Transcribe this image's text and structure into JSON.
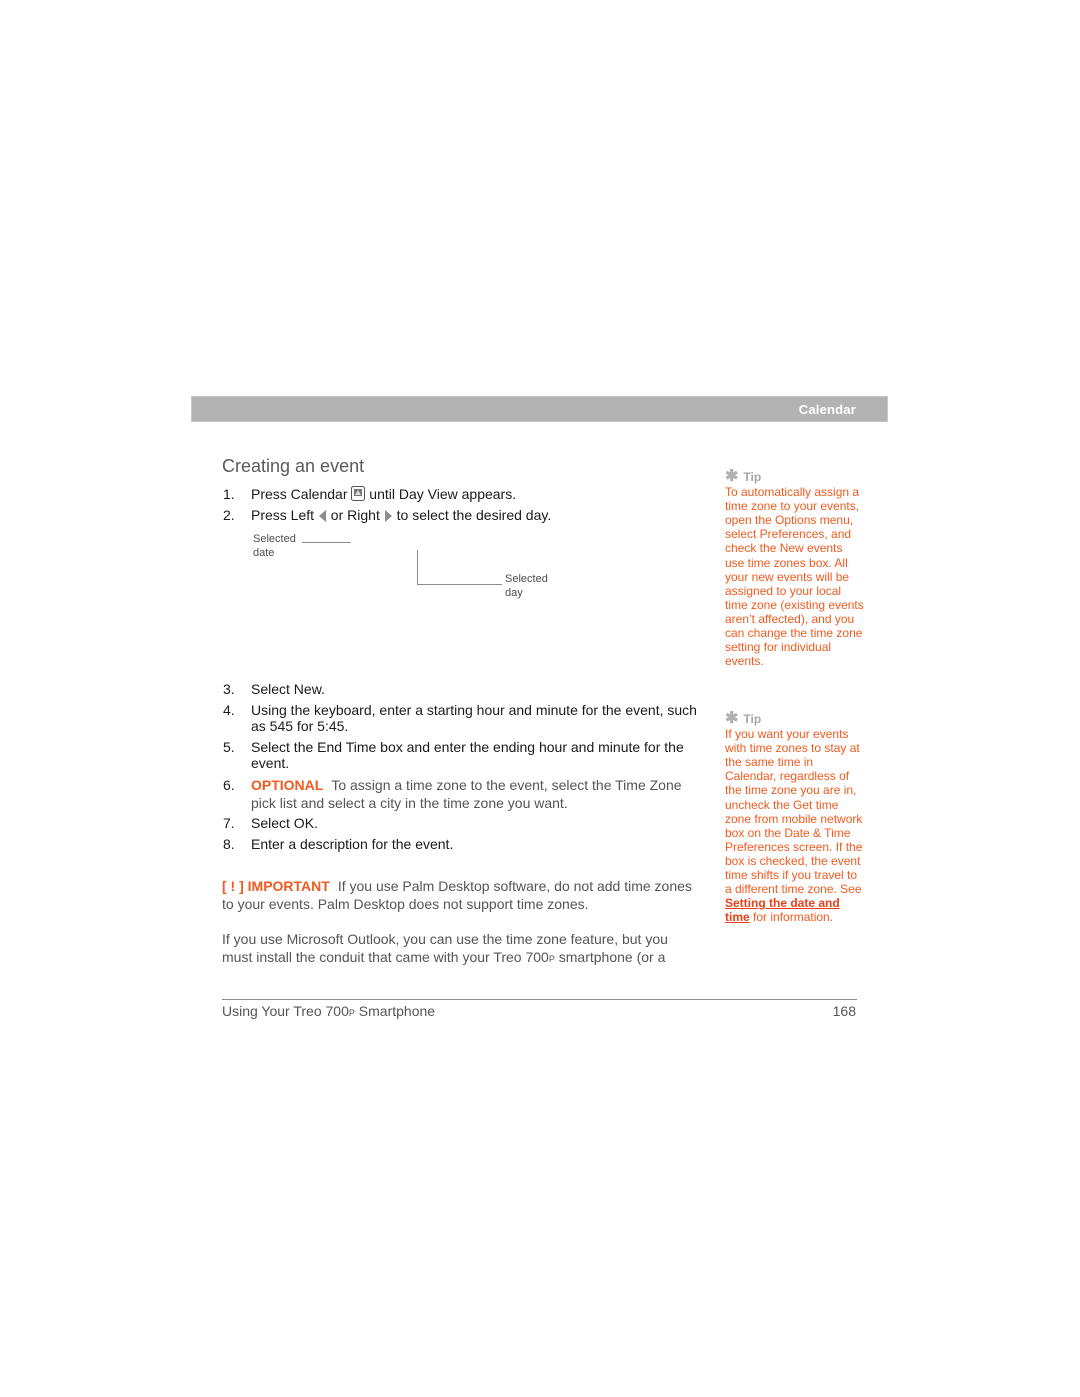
{
  "header": {
    "section_title": "Calendar"
  },
  "main": {
    "title": "Creating an event",
    "steps_top": [
      {
        "num": "1.",
        "before_icon": "Press Calendar ",
        "icon": "calendar-app-icon",
        "after_icon": " until Day View appears."
      },
      {
        "num": "2.",
        "part1": "Press Left ",
        "icon1": "left-arrow-icon",
        "part2": " or Right ",
        "icon2": "right-arrow-icon",
        "part3": " to select the desired day."
      }
    ],
    "callouts": {
      "selected_date": [
        "Selected",
        "date"
      ],
      "selected_day": [
        "Selected",
        "day"
      ]
    },
    "steps_bottom": [
      {
        "num": "3.",
        "text": "Select New."
      },
      {
        "num": "4.",
        "text": "Using the keyboard, enter a starting hour and minute for the event, such as 545 for 5:45."
      },
      {
        "num": "5.",
        "text": "Select the End Time box and enter the ending hour and minute for the event."
      },
      {
        "num": "6.",
        "label": "OPTIONAL",
        "text": "To assign a time zone to the event, select the Time Zone pick list and select a city in the time zone you want."
      },
      {
        "num": "7.",
        "text": "Select OK."
      },
      {
        "num": "8.",
        "text": "Enter a description for the event."
      }
    ],
    "important": {
      "label": "[ ! ] IMPORTANT",
      "text": "If you use Palm Desktop software, do not add time zones to your events. Palm Desktop does not support time zones."
    },
    "paragraph": {
      "text_before": "If you use Microsoft Outlook, you can use the time zone feature, but you must install the conduit that came with your Treo 700",
      "small_p": "P",
      "text_after": " smartphone (or a"
    }
  },
  "sidebar": {
    "tips": [
      {
        "heading": "Tip",
        "text": "To automatically assign a time zone to your events, open the Options menu, select Preferences, and check the New events use time zones box. All your new events will be assigned to your local time zone (existing events aren’t affected), and you can change the time zone setting for individual events."
      },
      {
        "heading": "Tip",
        "text_before": "If you want your events with time zones to stay at the same time in Calendar, regardless of the time zone you are in, uncheck the Get time zone from mobile network box on the Date & Time Preferences screen. If the box is checked, the event time shifts if you travel to a different time zone. See ",
        "link": "Setting the date and time",
        "text_after": " for information."
      }
    ]
  },
  "footer": {
    "title_before": "Using Your Treo 700",
    "title_small_p": "P",
    "title_after": " Smartphone",
    "page_number": "168"
  },
  "colors": {
    "accent_orange": "#f05a1e",
    "header_gray": "#b3b3b3",
    "tip_gray": "#a8a8a8"
  }
}
